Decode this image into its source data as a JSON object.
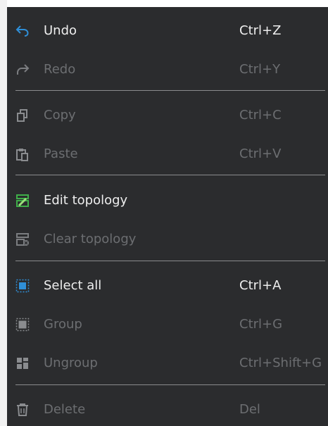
{
  "menu": {
    "items": [
      {
        "label": "Undo",
        "shortcut": "Ctrl+Z",
        "icon": "undo-icon",
        "enabled": true
      },
      {
        "label": "Redo",
        "shortcut": "Ctrl+Y",
        "icon": "redo-icon",
        "enabled": false
      },
      {
        "label": "Copy",
        "shortcut": "Ctrl+C",
        "icon": "copy-icon",
        "enabled": false
      },
      {
        "label": "Paste",
        "shortcut": "Ctrl+V",
        "icon": "paste-icon",
        "enabled": false
      },
      {
        "label": "Edit topology",
        "shortcut": "",
        "icon": "edit-topology-icon",
        "enabled": true
      },
      {
        "label": "Clear topology",
        "shortcut": "",
        "icon": "clear-topology-icon",
        "enabled": false
      },
      {
        "label": "Select all",
        "shortcut": "Ctrl+A",
        "icon": "select-all-icon",
        "enabled": true
      },
      {
        "label": "Group",
        "shortcut": "Ctrl+G",
        "icon": "group-icon",
        "enabled": false
      },
      {
        "label": "Ungroup",
        "shortcut": "Ctrl+Shift+G",
        "icon": "ungroup-icon",
        "enabled": false
      },
      {
        "label": "Delete",
        "shortcut": "Del",
        "icon": "delete-icon",
        "enabled": false
      }
    ]
  },
  "colors": {
    "background": "#2b2c2e",
    "text_enabled": "#eeeeee",
    "text_disabled": "#6c6e71",
    "accent_blue": "#2f8fd8",
    "accent_green": "#3fae49",
    "separator": "#8a8b8d"
  }
}
